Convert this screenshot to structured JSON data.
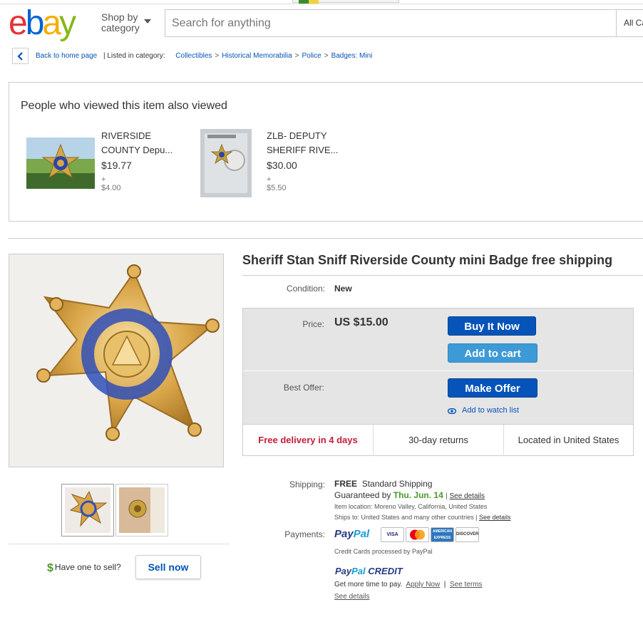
{
  "header": {
    "logo_letters": [
      "e",
      "b",
      "a",
      "y"
    ],
    "shop_by_line1": "Shop by",
    "shop_by_line2": "category",
    "search_placeholder": "Search for anything",
    "category_select": "All Ca"
  },
  "breadcrumb": {
    "back_label": "Back to home page",
    "listed_in": "| Listed in category:",
    "items": [
      "Collectibles",
      "Historical Memorabilia",
      "Police",
      "Badges: Mini"
    ],
    "separator": ">"
  },
  "also_viewed": {
    "heading": "People who viewed this item also viewed",
    "items": [
      {
        "title_line1": "RIVERSIDE",
        "title_line2": "COUNTY Depu...",
        "price": "$19.77",
        "shipping": "+ $4.00"
      },
      {
        "title_line1": "ZLB- DEPUTY",
        "title_line2": "SHERIFF RIVE...",
        "price": "$30.00",
        "shipping": "+ $5.50"
      }
    ]
  },
  "item": {
    "title": "Sheriff Stan Sniff Riverside County mini Badge free shipping",
    "condition_label": "Condition:",
    "condition_value": "New",
    "price_label": "Price:",
    "price_value": "US $15.00",
    "buy_now": "Buy It Now",
    "add_to_cart": "Add to cart",
    "best_offer_label": "Best Offer:",
    "make_offer": "Make Offer",
    "watch_list": "Add to watch list",
    "free_delivery": "Free delivery in 4 days",
    "returns": "30-day returns",
    "location": "Located in United States"
  },
  "shipping": {
    "label": "Shipping:",
    "free": "FREE",
    "method": "Standard Shipping",
    "guaranteed_prefix": "Guaranteed by",
    "guaranteed_date": "Thu. Jun. 14",
    "see_details": "See details",
    "item_location": "Item location:  Moreno Valley, California, United States",
    "ships_to": "Ships to:  United States and many other countries |",
    "see_details2": "See details"
  },
  "payments": {
    "label": "Payments:",
    "paypal_pay": "Pay",
    "paypal_pal": "Pal",
    "cards": [
      "VISA",
      "MasterCard",
      "AMERICAN EXPRESS",
      "DISCOVER"
    ],
    "processed": "Credit Cards processed by PayPal",
    "credit_label": "CREDIT",
    "more_time": "Get more time to pay.",
    "apply_now": "Apply Now",
    "see_terms": "See terms",
    "see_details": "See details"
  },
  "sell": {
    "dollar": "$",
    "prompt": "Have one to sell?",
    "button": "Sell now"
  },
  "colors": {
    "ebay_red": "#e53238",
    "ebay_blue": "#0064d2",
    "ebay_yellow": "#f5af02",
    "ebay_green": "#86b817",
    "button_blue": "#0654ba",
    "button_light_blue": "#3d9ad7",
    "free_delivery_red": "#c41e3a"
  }
}
